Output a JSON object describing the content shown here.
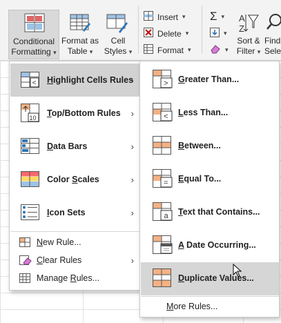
{
  "ribbon": {
    "conditional_formatting": {
      "line1": "Conditional",
      "line2": "Formatting"
    },
    "format_as_table": {
      "line1": "Format as",
      "line2": "Table"
    },
    "cell_styles": {
      "line1": "Cell",
      "line2": "Styles"
    },
    "insert": "Insert",
    "delete": "Delete",
    "format": "Format",
    "sort_filter": {
      "line1": "Sort &",
      "line2": "Filter"
    },
    "find_select": {
      "line1": "Find",
      "line2": "Select"
    }
  },
  "menu": {
    "items": [
      {
        "pre": "",
        "key": "H",
        "post": "ighlight Cells Rules",
        "icon": "highlight-cells-icon"
      },
      {
        "pre": "",
        "key": "T",
        "post": "op/Bottom Rules",
        "icon": "top-bottom-icon"
      },
      {
        "pre": "",
        "key": "D",
        "post": "ata Bars",
        "icon": "data-bars-icon"
      },
      {
        "pre": "Color ",
        "key": "S",
        "post": "cales",
        "icon": "color-scales-icon"
      },
      {
        "pre": "",
        "key": "I",
        "post": "con Sets",
        "icon": "icon-sets-icon"
      }
    ],
    "new_rule": {
      "pre": "",
      "key": "N",
      "post": "ew Rule..."
    },
    "clear_rules": {
      "pre": "",
      "key": "C",
      "post": "lear Rules"
    },
    "manage_rules": {
      "pre": "Manage ",
      "key": "R",
      "post": "ules..."
    }
  },
  "submenu": {
    "items": [
      {
        "pre": "",
        "key": "G",
        "post": "reater Than..."
      },
      {
        "pre": "",
        "key": "L",
        "post": "ess Than..."
      },
      {
        "pre": "",
        "key": "B",
        "post": "etween..."
      },
      {
        "pre": "",
        "key": "E",
        "post": "qual To..."
      },
      {
        "pre": "",
        "key": "T",
        "post": "ext that Contains..."
      },
      {
        "pre": "",
        "key": "A",
        "post": " Date Occurring..."
      },
      {
        "pre": "",
        "key": "D",
        "post": "uplicate Values..."
      }
    ],
    "more_rules": {
      "pre": "",
      "key": "M",
      "post": "ore Rules..."
    }
  },
  "colors": {
    "selected": "#d2d2d2",
    "hover": "#d6d6d6",
    "accent_orange": "#f4b183",
    "accent_yellow": "#ffd966",
    "accent_blue": "#2e75b6"
  }
}
